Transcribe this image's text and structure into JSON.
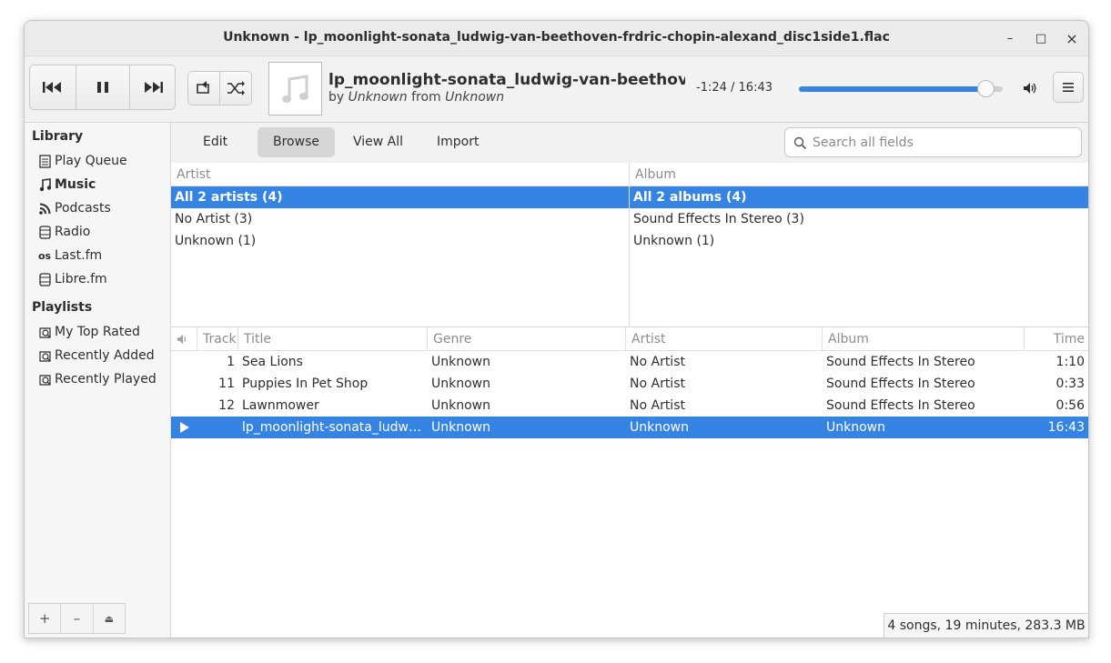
{
  "window": {
    "title": "Unknown - lp_moonlight-sonata_ludwig-van-beethoven-frdric-chopin-alexand_disc1side1.flac",
    "controls": [
      "–",
      "□",
      "×"
    ]
  },
  "header": {
    "now_playing": {
      "title": "lp_moonlight-sonata_ludwig-van-beethoven-…",
      "by_label": "by",
      "artist": "Unknown",
      "from_label": "from",
      "album": "Unknown"
    },
    "time": "-1:24 / 16:43",
    "progress_fraction": 0.915
  },
  "sidebar": {
    "library_heading": "Library",
    "library_items": [
      {
        "label": "Play Queue",
        "icon": "document-icon"
      },
      {
        "label": "Music",
        "icon": "music-note-icon",
        "active": true
      },
      {
        "label": "Podcasts",
        "icon": "rss-icon"
      },
      {
        "label": "Radio",
        "icon": "radio-icon"
      },
      {
        "label": "Last.fm",
        "icon": "lastfm-icon"
      },
      {
        "label": "Libre.fm",
        "icon": "librefm-icon"
      }
    ],
    "playlists_heading": "Playlists",
    "playlist_items": [
      {
        "label": "My Top Rated",
        "icon": "smart-playlist-icon"
      },
      {
        "label": "Recently Added",
        "icon": "smart-playlist-icon"
      },
      {
        "label": "Recently Played",
        "icon": "smart-playlist-icon"
      }
    ],
    "bottom_buttons": [
      "+",
      "–",
      "⏏"
    ]
  },
  "toolbar": {
    "tabs": [
      "Edit",
      "Browse",
      "View All",
      "Import"
    ],
    "active_tab": "Browse",
    "search_placeholder": "Search all fields"
  },
  "browser": {
    "artist_header": "Artist",
    "artists": [
      "All 2 artists (4)",
      "No Artist (3)",
      "Unknown (1)"
    ],
    "album_header": "Album",
    "albums": [
      "All 2 albums (4)",
      "Sound Effects In Stereo (3)",
      "Unknown (1)"
    ]
  },
  "tracklist": {
    "columns": [
      "Track",
      "Title",
      "Genre",
      "Artist",
      "Album",
      "Time"
    ],
    "rows": [
      {
        "track": "1",
        "title": "Sea Lions",
        "genre": "Unknown",
        "artist": "No Artist",
        "album": "Sound Effects In Stereo",
        "time": "1:10"
      },
      {
        "track": "11",
        "title": "Puppies In Pet Shop",
        "genre": "Unknown",
        "artist": "No Artist",
        "album": "Sound Effects In Stereo",
        "time": "0:33"
      },
      {
        "track": "12",
        "title": "Lawnmower",
        "genre": "Unknown",
        "artist": "No Artist",
        "album": "Sound Effects In Stereo",
        "time": "0:56"
      },
      {
        "track": "",
        "title": "lp_moonlight-sonata_ludwi…",
        "genre": "Unknown",
        "artist": "Unknown",
        "album": "Unknown",
        "time": "16:43",
        "playing": true
      }
    ]
  },
  "status": "4 songs, 19 minutes, 283.3 MB",
  "colors": {
    "accent": "#3584e4"
  }
}
